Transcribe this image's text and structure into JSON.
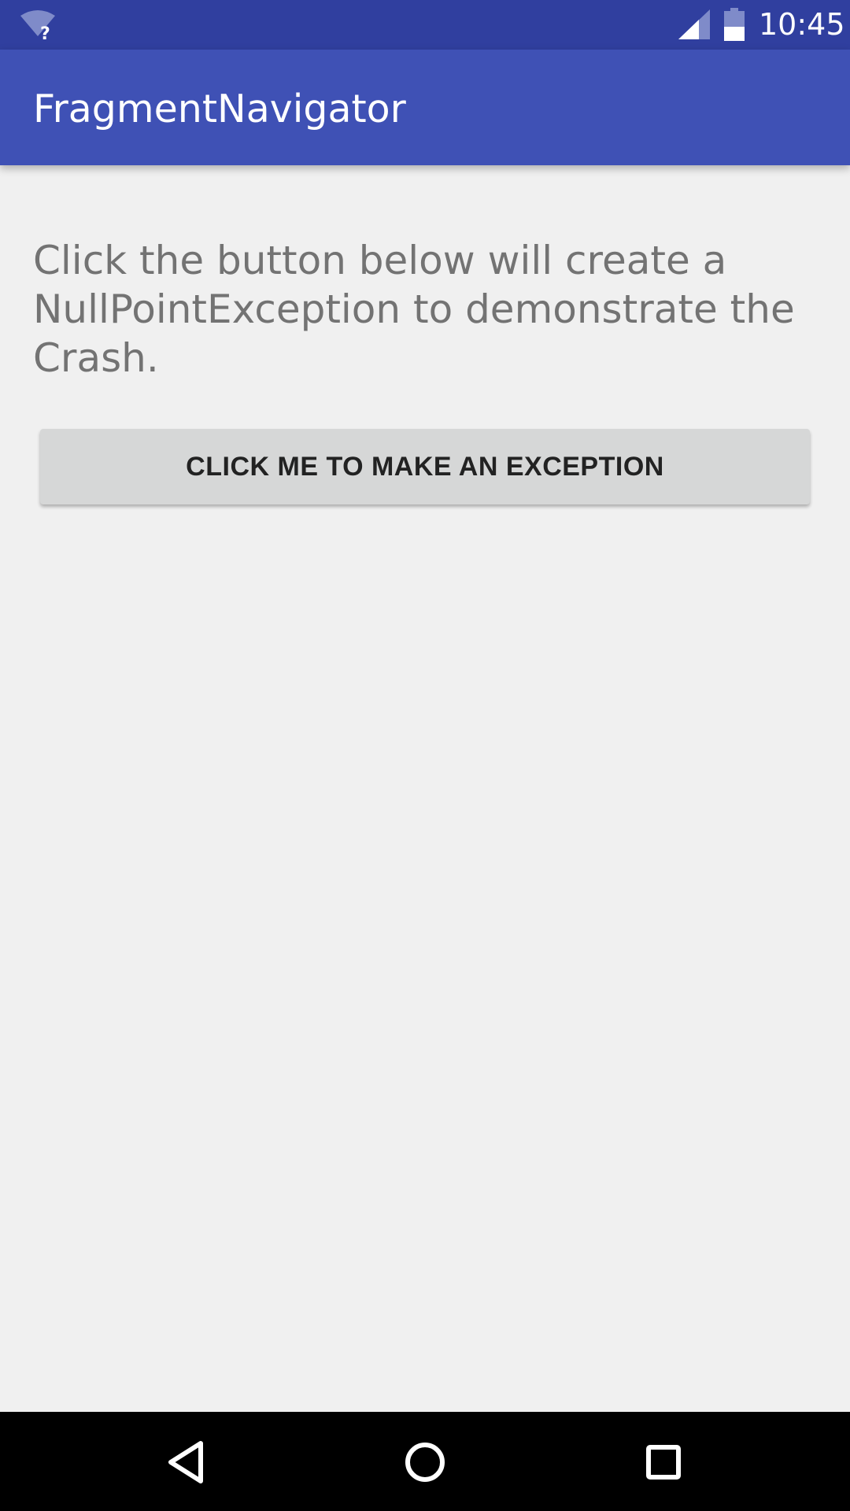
{
  "status_bar": {
    "time": "10:45",
    "wifi_icon": "wifi-unknown-icon",
    "signal_icon": "cell-signal-icon",
    "battery_icon": "battery-icon",
    "background_color": "#303f9f"
  },
  "app_bar": {
    "title": "FragmentNavigator",
    "background_color": "#3f51b5"
  },
  "main": {
    "description": "Click the button below will create a NullPointException to demonstrate the Crash.",
    "button_label": "CLICK ME TO MAKE AN EXCEPTION"
  },
  "nav_bar": {
    "back_icon": "back-triangle-icon",
    "home_icon": "home-circle-icon",
    "recents_icon": "recents-square-icon"
  }
}
